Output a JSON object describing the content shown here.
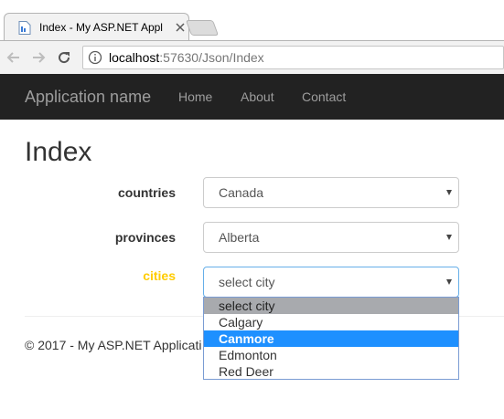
{
  "browser": {
    "tab_title": "Index - My ASP.NET Appl",
    "url_host": "localhost",
    "url_rest": ":57630/Json/Index"
  },
  "navbar": {
    "brand": "Application name",
    "links": [
      "Home",
      "About",
      "Contact"
    ]
  },
  "page": {
    "title": "Index",
    "fields": [
      {
        "label": "countries",
        "value": "Canada"
      },
      {
        "label": "provinces",
        "value": "Alberta"
      },
      {
        "label": "cities",
        "value": "select city"
      }
    ],
    "footer": "© 2017 - My ASP.NET Applicati"
  },
  "cities_dropdown": {
    "options": [
      "select city",
      "Calgary",
      "Canmore",
      "Edmonton",
      "Red Deer"
    ],
    "highlighted": "Canmore"
  },
  "colors": {
    "navbar_bg": "#222222",
    "active_label": "#ffcc00",
    "option_highlight": "#1e90ff",
    "focus_border": "#66afe9"
  },
  "icons": {
    "favicon": "page-icon",
    "tab_close": "close-icon",
    "back": "back-arrow-icon",
    "forward": "forward-arrow-icon",
    "reload": "reload-icon",
    "site_info": "info-icon",
    "select_caret": "caret-down-icon"
  }
}
